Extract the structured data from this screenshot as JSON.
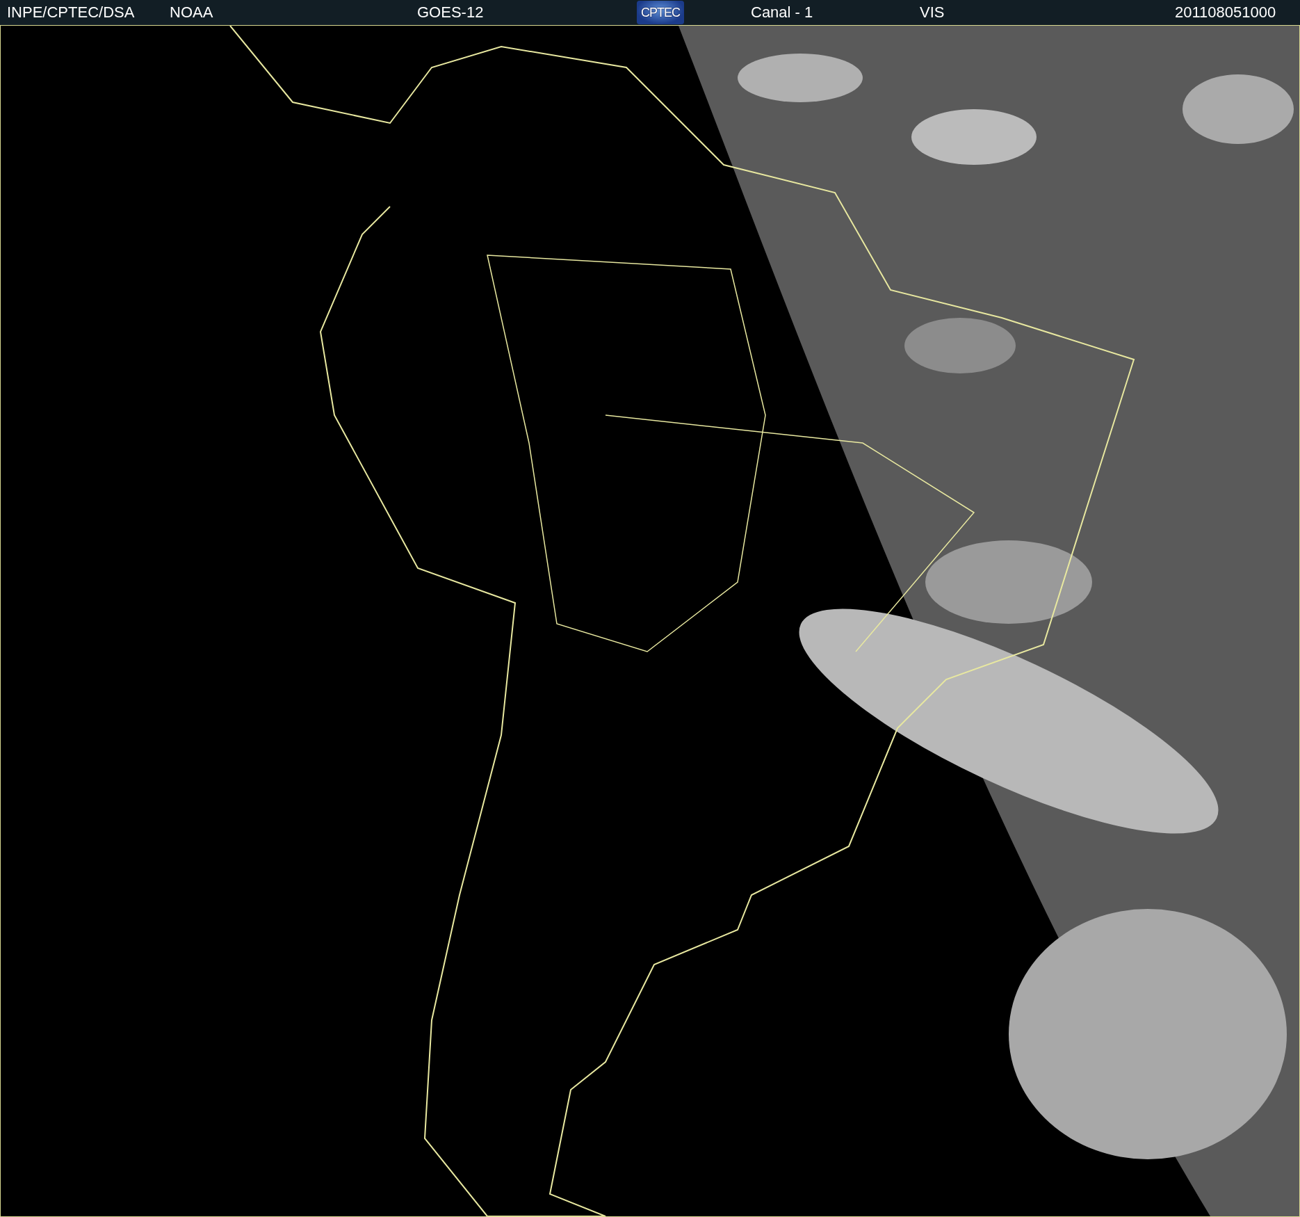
{
  "header": {
    "source": "INPE/CPTEC/DSA",
    "agency": "NOAA",
    "satellite": "GOES-12",
    "logo_text": "CPTEC",
    "channel": "Canal - 1",
    "band": "VIS",
    "timestamp": "201108051000"
  }
}
